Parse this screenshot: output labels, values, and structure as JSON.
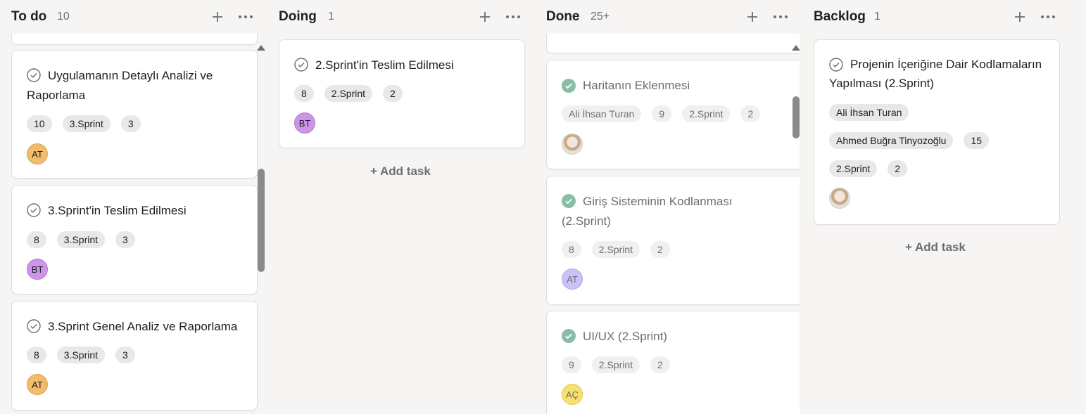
{
  "columns": [
    {
      "title": "To do",
      "count": "10",
      "cards": [
        {
          "title": "Uygulamanın Detaylı Analizi ve Raporlama",
          "chips": [
            "10",
            "3.Sprint",
            "3"
          ],
          "avatar": "AT"
        },
        {
          "title": "3.Sprint'in Teslim Edilmesi",
          "chips": [
            "8",
            "3.Sprint",
            "3"
          ],
          "avatar": "BT"
        },
        {
          "title": "3.Sprint Genel Analiz ve Raporlama",
          "chips": [
            "8",
            "3.Sprint",
            "3"
          ],
          "avatar": "AT"
        }
      ]
    },
    {
      "title": "Doing",
      "count": "1",
      "cards": [
        {
          "title": "2.Sprint'in Teslim Edilmesi",
          "chips": [
            "8",
            "2.Sprint",
            "2"
          ],
          "avatar": "BT"
        }
      ],
      "add_label": "+ Add task"
    },
    {
      "title": "Done",
      "count": "25+",
      "cards": [
        {
          "title": "Haritanın Eklenmesi",
          "chips": [
            "Ali İhsan Turan",
            "9",
            "2.Sprint",
            "2"
          ],
          "avatar": ""
        },
        {
          "title": "Giriş Sisteminin Kodlanması (2.Sprint)",
          "chips": [
            "8",
            "2.Sprint",
            "2"
          ],
          "avatar": "AT"
        },
        {
          "title": "UI/UX (2.Sprint)",
          "chips": [
            "9",
            "2.Sprint",
            "2"
          ],
          "avatar": "AÇ"
        }
      ]
    },
    {
      "title": "Backlog",
      "count": "1",
      "cards": [
        {
          "title": "Projenin İçeriğine Dair Kodlamaların Yapılması (2.Sprint)",
          "chips_row1": [
            "Ali İhsan Turan"
          ],
          "chips_row2": [
            "Ahmed Buğra Tinyozoğlu",
            "15"
          ],
          "chips_row3": [
            "2.Sprint",
            "2"
          ],
          "avatar": ""
        }
      ],
      "add_label": "+ Add task"
    }
  ],
  "icons": {
    "add": "plus-icon",
    "more": "more-horizontal-icon",
    "check": "check-circle-icon",
    "scroll_up": "scroll-up-arrow-icon"
  },
  "colors": {
    "background": "#f6f5f4",
    "avatar_at": "#f1bd6c",
    "avatar_bt": "#cd95ea",
    "avatar_at_done": "#c9c2f6",
    "avatar_ac": "#f8df72",
    "done_check": "#58a182"
  }
}
